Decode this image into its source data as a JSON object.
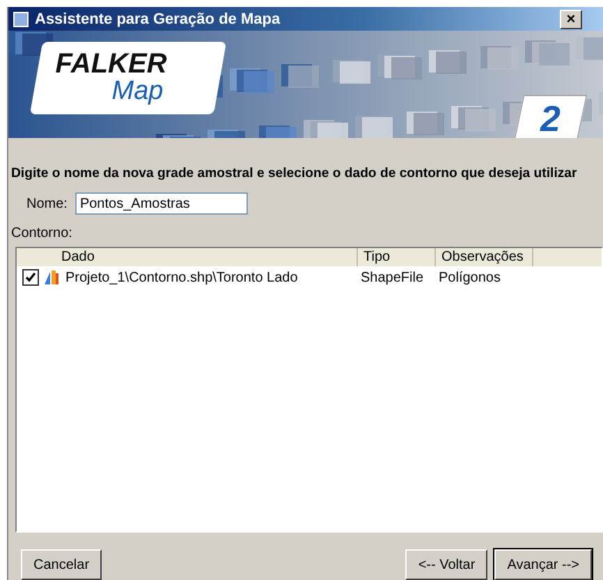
{
  "window": {
    "title": "Assistente para Geração de Mapa",
    "close": "×"
  },
  "banner": {
    "logo_line_1": "FALKER",
    "logo_line_2": "Map",
    "step": "2"
  },
  "instruction": "Digite o nome da nova grade amostral e selecione o dado de contorno que deseja utilizar",
  "name_field": {
    "label": "Nome:",
    "value": "Pontos_Amostras"
  },
  "contour_label": "Contorno:",
  "table": {
    "columns": [
      "Dado",
      "Tipo",
      "Observações"
    ],
    "rows": [
      {
        "checked": true,
        "cells": [
          "Projeto_1\\Contorno.shp\\Toronto Lado",
          "ShapeFile",
          "Polígonos"
        ]
      }
    ]
  },
  "buttons": {
    "cancel": "Cancelar",
    "back": "<-- Voltar",
    "next": "Avançar -->"
  }
}
